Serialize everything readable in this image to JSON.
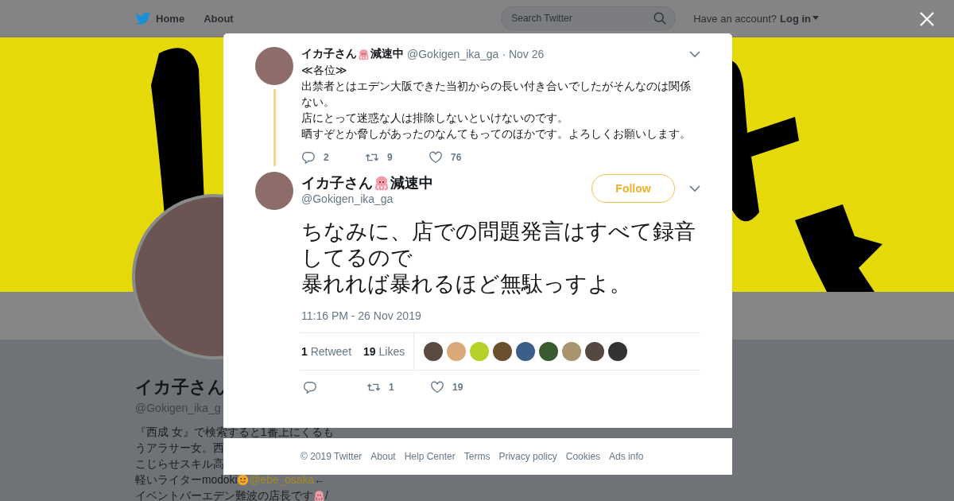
{
  "nav": {
    "items": [
      {
        "label": "Home"
      },
      {
        "label": "About"
      }
    ],
    "search": {
      "placeholder": "Search Twitter"
    },
    "account_prompt": "Have an account?",
    "login": "Log in"
  },
  "profile": {
    "name": "イカ子さん",
    "handle": "@Gokigen_ika_g",
    "bio_lines": [
      [
        {
          "kind": "text",
          "text": "『西成 女』で検索すると1番上にくるも"
        }
      ],
      [
        {
          "kind": "text",
          "text": "うアラサー女。西"
        }
      ],
      [
        {
          "kind": "text",
          "text": "こじらせスキル高"
        }
      ],
      [
        {
          "kind": "text",
          "text": "軽いライターmodoki"
        },
        {
          "kind": "face"
        },
        {
          "kind": "link",
          "text": "@ebe_osaka"
        },
        {
          "kind": "text",
          "text": "←"
        }
      ],
      [
        {
          "kind": "text",
          "text": "イベントバーエデン難波の店長です"
        },
        {
          "kind": "octopus"
        },
        {
          "kind": "text",
          "text": "/"
        }
      ]
    ]
  },
  "tweets": [
    {
      "kind": "context",
      "name_parts": [
        "イカ子さん",
        "減速中"
      ],
      "handle": "@Gokigen_ika_ga",
      "date": "· Nov 26",
      "lines": [
        "≪各位≫",
        "出禁者とはエデン大阪できた当初からの長い付き合いでしたがそんなのは関係ない。",
        "店にとって迷惑な人は排除しないといけないのです。",
        "晒すぞとか脅しがあったのなんてもってのほかです。よろしくお願いします。"
      ],
      "actions": {
        "replies": "2",
        "retweets": "9",
        "likes": "76"
      }
    },
    {
      "kind": "main",
      "name_parts": [
        "イカ子さん",
        "減速中"
      ],
      "handle": "@Gokigen_ika_ga",
      "follow": "Follow",
      "lines": [
        "ちなみに、店での問題発言はすべて録音してるので",
        "暴れれば暴れるほど無駄っすよ。"
      ],
      "timestamp": "11:16 PM - 26 Nov 2019",
      "stats": [
        {
          "count": "1",
          "label": "Retweet"
        },
        {
          "count": "19",
          "label": "Likes"
        }
      ],
      "actions": {
        "retweets": "1",
        "likes": "19"
      }
    }
  ],
  "footer": [
    "© 2019 Twitter",
    "About",
    "Help Center",
    "Terms",
    "Privacy policy",
    "Cookies",
    "Ads info"
  ]
}
